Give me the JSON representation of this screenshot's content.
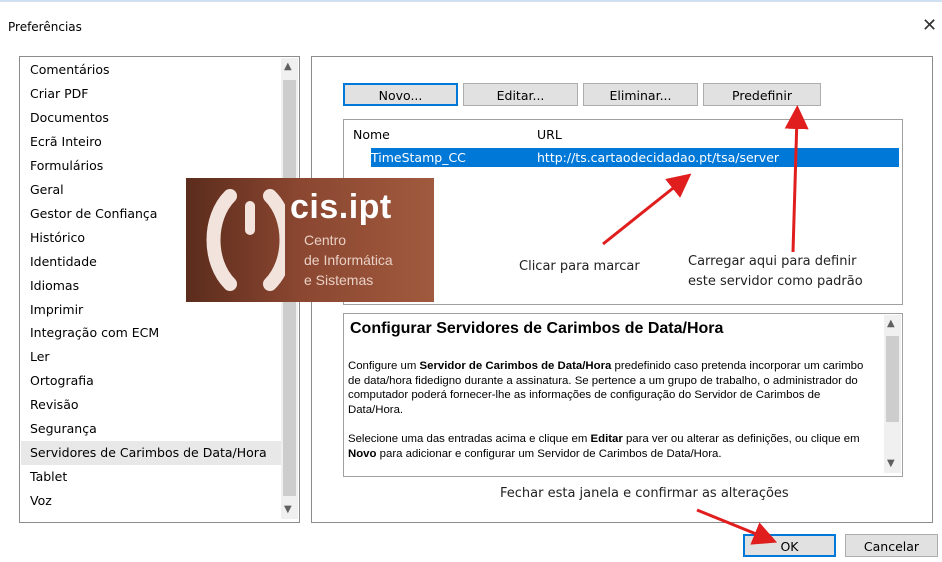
{
  "window": {
    "title": "Preferências",
    "close_glyph": "✕"
  },
  "sidebar": {
    "items": [
      {
        "label": "Comentários"
      },
      {
        "label": "Criar PDF"
      },
      {
        "label": "Documentos"
      },
      {
        "label": "Ecrã Inteiro"
      },
      {
        "label": "Formulários"
      },
      {
        "label": "Geral"
      },
      {
        "label": "Gestor de Confiança"
      },
      {
        "label": "Histórico"
      },
      {
        "label": "Identidade"
      },
      {
        "label": "Idiomas"
      },
      {
        "label": "Imprimir"
      },
      {
        "label": "Integração com ECM"
      },
      {
        "label": "Ler"
      },
      {
        "label": "Ortografia"
      },
      {
        "label": "Revisão"
      },
      {
        "label": "Segurança"
      },
      {
        "label": "Servidores de Carimbos de Data/Hora"
      },
      {
        "label": "Tablet"
      },
      {
        "label": "Voz"
      }
    ],
    "selected_index": 16
  },
  "toolbar": {
    "new_label": "Novo...",
    "edit_label": "Editar...",
    "delete_label": "Eliminar...",
    "default_label": "Predefinir"
  },
  "server_list": {
    "columns": [
      "Nome",
      "URL"
    ],
    "rows": [
      {
        "name": "TimeStamp_CC",
        "url": "http://ts.cartaodecidadao.pt/tsa/server"
      }
    ]
  },
  "help": {
    "heading": "Configurar Servidores de Carimbos de Data/Hora",
    "p1_a": "Configure um ",
    "p1_b": "Servidor de Carimbos de Data/Hora",
    "p1_c": " predefinido caso pretenda incorporar um carimbo de data/hora fidedigno durante a assinatura. Se pertence a um grupo de trabalho, o administrador do computador poderá fornecer-lhe as informações de configuração do Servidor de Carimbos de Data/Hora.",
    "p2_a": "Selecione uma das entradas acima e clique em ",
    "p2_b": "Editar",
    "p2_c": " para ver ou alterar as definições, ou clique em ",
    "p2_d": "Novo",
    "p2_e": " para adicionar e configurar um Servidor de Carimbos de Data/Hora."
  },
  "annotations": {
    "click_to_mark": "Clicar para marcar",
    "set_default_line1": "Carregar aqui para definir",
    "set_default_line2": "este servidor como padrão",
    "close_confirm": "Fechar esta janela e confirmar as alterações"
  },
  "footer": {
    "ok_label": "OK",
    "cancel_label": "Cancelar"
  },
  "logo": {
    "brand": "cis.ipt",
    "line1": "Centro",
    "line2": "de Informática",
    "line3": "e Sistemas"
  },
  "colors": {
    "accent": "#0078d7",
    "arrow": "#e01e1e"
  }
}
